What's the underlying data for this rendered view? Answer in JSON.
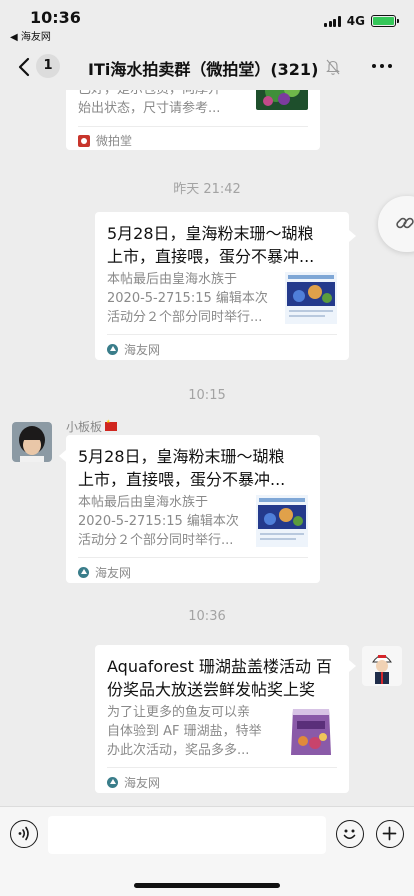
{
  "status_bar": {
    "time": "10:36",
    "back_app": "◀ 海友网",
    "network": "4G"
  },
  "nav": {
    "badge": "1",
    "title": "ITi海水拍卖群（微拍堂）(321)"
  },
  "messages": {
    "card0": {
      "desc_line1": "已好，是示包员，向厚开",
      "desc_line2": "始出状态，尺寸请参考...",
      "source": "微拍堂"
    },
    "ts1": "昨天 21:42",
    "card1": {
      "title_line1": "5月28日，皇海粉末珊～瑚粮",
      "title_line2": "上市，直接喂，蛋分不暴冲...",
      "desc_line1": "本帖最后由皇海水族于",
      "desc_line2": "2020-5-2715:15 编辑本次",
      "desc_line3": "活动分２个部分同时举行...",
      "source": "海友网"
    },
    "ts2": "10:15",
    "sender2": "小板板",
    "card2": {
      "title_line1": "5月28日，皇海粉末珊～瑚粮",
      "title_line2": "上市，直接喂，蛋分不暴冲...",
      "desc_line1": "本帖最后由皇海水族于",
      "desc_line2": "2020-5-2715:15 编辑本次",
      "desc_line3": "活动分２个部分同时举行...",
      "source": "海友网"
    },
    "ts3": "10:36",
    "card3": {
      "title_line1": "Aquaforest 珊湖盐盖楼活动 百",
      "title_line2": "份奖品大放送尝鲜发帖奖上奖",
      "desc_line1": "为了让更多的鱼友可以亲",
      "desc_line2": "自体验到 AF 珊湖盐，特举",
      "desc_line3": "办此次活动，奖品多多...",
      "source": "海友网"
    }
  },
  "icons": {
    "back": "chevron-left-icon",
    "mute": "bell-off-icon",
    "more": "more-icon",
    "link": "link-icon",
    "voice": "voice-icon",
    "emoji": "emoji-icon",
    "plus": "plus-icon"
  },
  "colors": {
    "background": "#ededed",
    "bubble": "#ffffff",
    "secondary_text": "#8a8a8a",
    "battery": "#35c759",
    "source_icon_haiyou": "#3a7d8a",
    "source_icon_weipaitang": "#c8352c"
  }
}
